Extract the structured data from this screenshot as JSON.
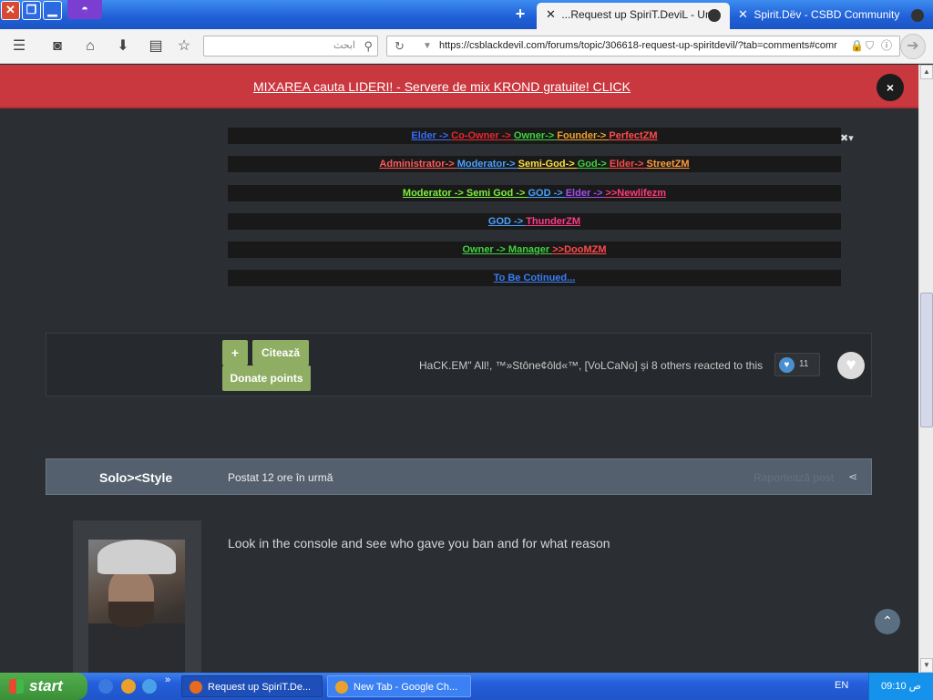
{
  "browser": {
    "tabs": [
      {
        "title": "...Request up SpiriT.DeviL - Unb",
        "active": true
      },
      {
        "title": "Spirit.Dëv - CSBD Community",
        "active": false
      }
    ],
    "search_placeholder": "ابحث",
    "url": "https://csblackdevil.com/forums/topic/306618-request-up-spiritdevil/?tab=comments#comr"
  },
  "banner": {
    "text": "MIXAREA cauta LIDERI! - Servere de mix KROND gratuite! CLICK",
    "close": "×"
  },
  "ranks": [
    [
      {
        "t": "Elder -> ",
        "c": "#3a6cf5"
      },
      {
        "t": "Co-Owner -> ",
        "c": "#e8262f"
      },
      {
        "t": "Owner-> ",
        "c": "#3fd13f"
      },
      {
        "t": "Founder-> ",
        "c": "#f0a030"
      },
      {
        "t": " PerfectZM",
        "c": "#ff4a4a"
      }
    ],
    [
      {
        "t": "Administrator-> ",
        "c": "#ff5a5a"
      },
      {
        "t": "Moderator-> ",
        "c": "#4aa0ff"
      },
      {
        "t": " Semi-God-> ",
        "c": "#ffe040"
      },
      {
        "t": "God-> ",
        "c": "#3fd13f"
      },
      {
        "t": "Elder-> ",
        "c": "#ff4a4a"
      },
      {
        "t": "StreetZM",
        "c": "#ff9a3a"
      }
    ],
    [
      {
        "t": "Moderator -> Semi God -> ",
        "c": "#7cf03c"
      },
      {
        "t": "GOD -> ",
        "c": "#4aa0ff"
      },
      {
        "t": "Elder -> ",
        "c": "#a050f0"
      },
      {
        "t": " >>Newlifezm",
        "c": "#ff3a7a"
      }
    ],
    [
      {
        "t": "GOD -> ",
        "c": "#4aa0ff"
      },
      {
        "t": " ThunderZM ",
        "c": "#ff3a8a"
      }
    ],
    [
      {
        "t": " Owner -> Manager ",
        "c": "#3fd13f"
      },
      {
        "t": ">>DooMZM",
        "c": "#ff4a4a"
      }
    ],
    [
      {
        "t": "To Be Cotinued...",
        "c": "#3a7cf5"
      }
    ]
  ],
  "reactions": {
    "plus": "+",
    "quote": "Citează",
    "donate": "Donate points",
    "summary": "HaCK.EM\" All!, ™»Stône¢ôld«™, [VoLCaNo] și 8 others reacted to this",
    "count": "11"
  },
  "post": {
    "author": "Solo><Style",
    "posted": "Postat 12 ore în urmă",
    "report": "Raportează post",
    "text": "Look in the console and see who gave you ban and for what reason"
  },
  "taskbar": {
    "start": "start",
    "tasks": [
      "Request up SpiriT.De...",
      "New Tab - Google Ch..."
    ],
    "lang": "EN",
    "time": "09:10 ص"
  }
}
